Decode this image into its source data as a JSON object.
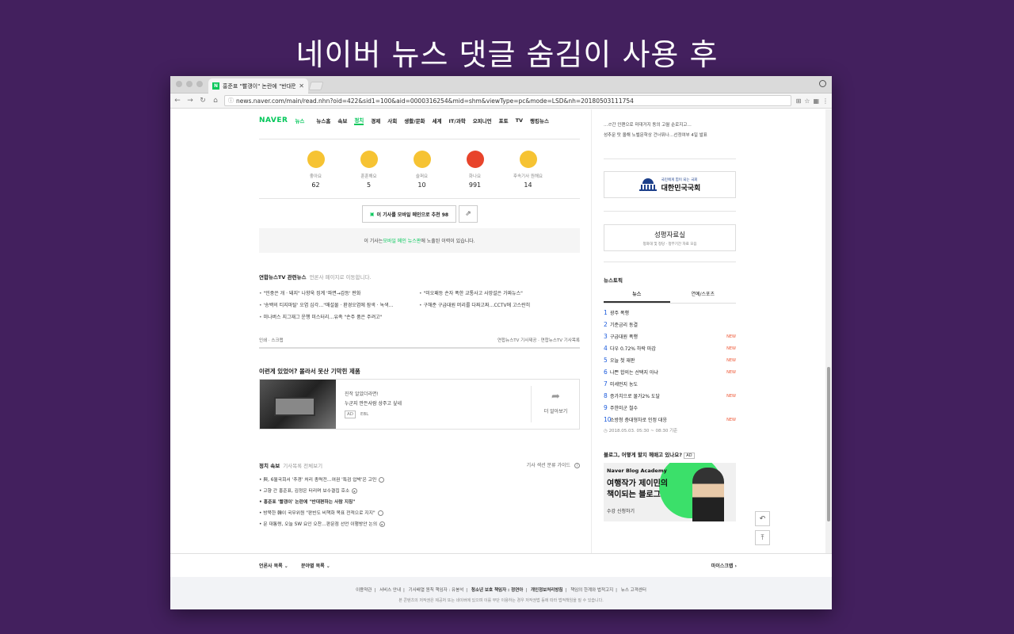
{
  "headline": "네이버 뉴스 댓글 숨김이 사용 후",
  "browser": {
    "tab_title": "홍준표 \"빨갱이\" 논란에 \"반대편하는...",
    "url": "news.naver.com/main/read.nhn?oid=422&sid1=100&aid=0000316254&mid=shm&viewType=pc&mode=LSD&nh=20180503111754"
  },
  "gnb": {
    "logo": "NAVER",
    "section": "뉴스",
    "items": [
      "뉴스홈",
      "속보",
      "정치",
      "경제",
      "사회",
      "생활/문화",
      "세계",
      "IT/과학",
      "오피니언",
      "포토",
      "TV",
      "랭킹뉴스"
    ]
  },
  "reactions": [
    {
      "label": "좋아요",
      "count": "62",
      "color": "#f6c333"
    },
    {
      "label": "훈훈해요",
      "count": "5",
      "color": "#f6c333"
    },
    {
      "label": "슬퍼요",
      "count": "10",
      "color": "#f6c333"
    },
    {
      "label": "화나요",
      "count": "991",
      "color": "#e8442b"
    },
    {
      "label": "후속기사 원해요",
      "count": "14",
      "color": "#f6c333"
    }
  ],
  "recommend_label": "이 기사를 모바일 메인으로 추천 98",
  "notice": {
    "pre": "이 기사는 ",
    "link": "모바일 메인 뉴스판",
    "post": "에 노출된 이력이 있습니다."
  },
  "related": {
    "title": "연합뉴스TV 관련뉴스",
    "sub": "언론사 페이지로 이동합니다.",
    "items": [
      "\"민중은 개 · 돼지\" 나향욱 징계 '파면→감등' 판화",
      "\"미오패등 손자 폭한 교통사고 사망설은 가짜뉴스\"",
      "'송백의 티지마탈' 오염 심각…\"매설물 · 환경오염에 잠색 · 녹색…",
      "구해준 구급대원 머리를 다짜고짜…CCTV에 고스란히",
      "미나버스 지그재그 운행 미스터리…유족 \"손주 품은 주려고\""
    ]
  },
  "tools": {
    "left": "인쇄 · 스크랩",
    "right": "연합뉴스TV 기사제공 · 연합뉴스TV 기사목록"
  },
  "ad": {
    "heading": "이런게 있었어? 몰라서 못산 기막힌 제품",
    "line1": "진작 알았더라면!",
    "line2": "누군지 만든사람 상주고 싶네",
    "tag": "AD",
    "brand": "EBL",
    "more": "더 알아보기"
  },
  "politics": {
    "title": "정치 속보",
    "sub": "기사목록 전체보기",
    "guide": "기사 섹션 분류 가이드",
    "items": [
      {
        "text": "與, 6월국회서 '추경' 처리 총력전…여권 '특검 압박'은 고민",
        "bold": false
      },
      {
        "text": "고향 간 홍준표, 김정은 터리며 보수결집 호소",
        "bold": false
      },
      {
        "text": "홍준표 '빨갱이' 논란에 \"반대편하는 사람 지칭\"",
        "bold": true
      },
      {
        "text": "방북한 韓이 국무위원 \"판빈도 비핵화 목표 전적으로 지지\"",
        "bold": false
      },
      {
        "text": "문 대통령, 오늘 SW 요인 오찬…판문점 선언 이행방안 논의",
        "bold": false
      }
    ]
  },
  "side": {
    "top_lines": [
      "…ㄹ간 인랜으로 미대거지 동의 고월 순로지고…",
      "성추문 탓 올해 노벨문학상 건너뛰나…선정여부 4일 발표"
    ],
    "banner1_small": "국민에게 힘이 되는 국회",
    "banner1_big": "대한민국국회",
    "banner2_big": "성평자료실",
    "banner2_small": "청와대 및 정당 · 정부기간 자료 모음",
    "topic_title": "뉴스토픽",
    "topic_tabs": [
      "뉴스",
      "연예/스포츠"
    ],
    "topics": [
      {
        "n": "1",
        "t": "광주 폭행",
        "new": ""
      },
      {
        "n": "2",
        "t": "기준금리 동결",
        "new": ""
      },
      {
        "n": "3",
        "t": "구급대원 폭행",
        "new": "NEW"
      },
      {
        "n": "4",
        "t": "다우 0.72% 하락 마감",
        "new": "NEW"
      },
      {
        "n": "5",
        "t": "오늘 첫 재판",
        "new": "NEW"
      },
      {
        "n": "6",
        "t": "나쁜 합의는 선택지 아냐",
        "new": "NEW"
      },
      {
        "n": "7",
        "t": "미세먼지 농도",
        "new": ""
      },
      {
        "n": "8",
        "t": "증가치으로 물가2% 도달",
        "new": "NEW"
      },
      {
        "n": "9",
        "t": "주한미군 철수",
        "new": ""
      },
      {
        "n": "10",
        "t": "소방청 층대형차로 인정 대응",
        "new": "NEW"
      }
    ],
    "topic_time": "2018.05.03. 05:30 ~ 08:30 기준",
    "blog_title": "블로그, 어떻게 할지 헤매고 있나요?",
    "blog_ad": "AD",
    "blog_l1": "Naver Blog Academy",
    "blog_l2a": "여행작가 제이민의",
    "blog_l2b": "책이되는 블로그",
    "blog_l3": "수강 신청하기"
  },
  "lower": {
    "a": "언론사 목록",
    "b": "분야별 목록",
    "c": "마이스크랩"
  },
  "footer": {
    "links": [
      "이용약관",
      "서비스 안내",
      "기사배열 원칙 책임자 : 유봉석",
      "청소년 보호 책임자 : 정연아",
      "개인정보처리방침",
      "책임의 한계와 법적고지",
      "뉴스 고객센터"
    ],
    "copyright": "본 콘텐츠의 저작권은 제공처 또는 네이버에 있으며 이를 무단 이용하는 경우 저작권법 등에 따라 법적책임을 질 수 있습니다."
  }
}
